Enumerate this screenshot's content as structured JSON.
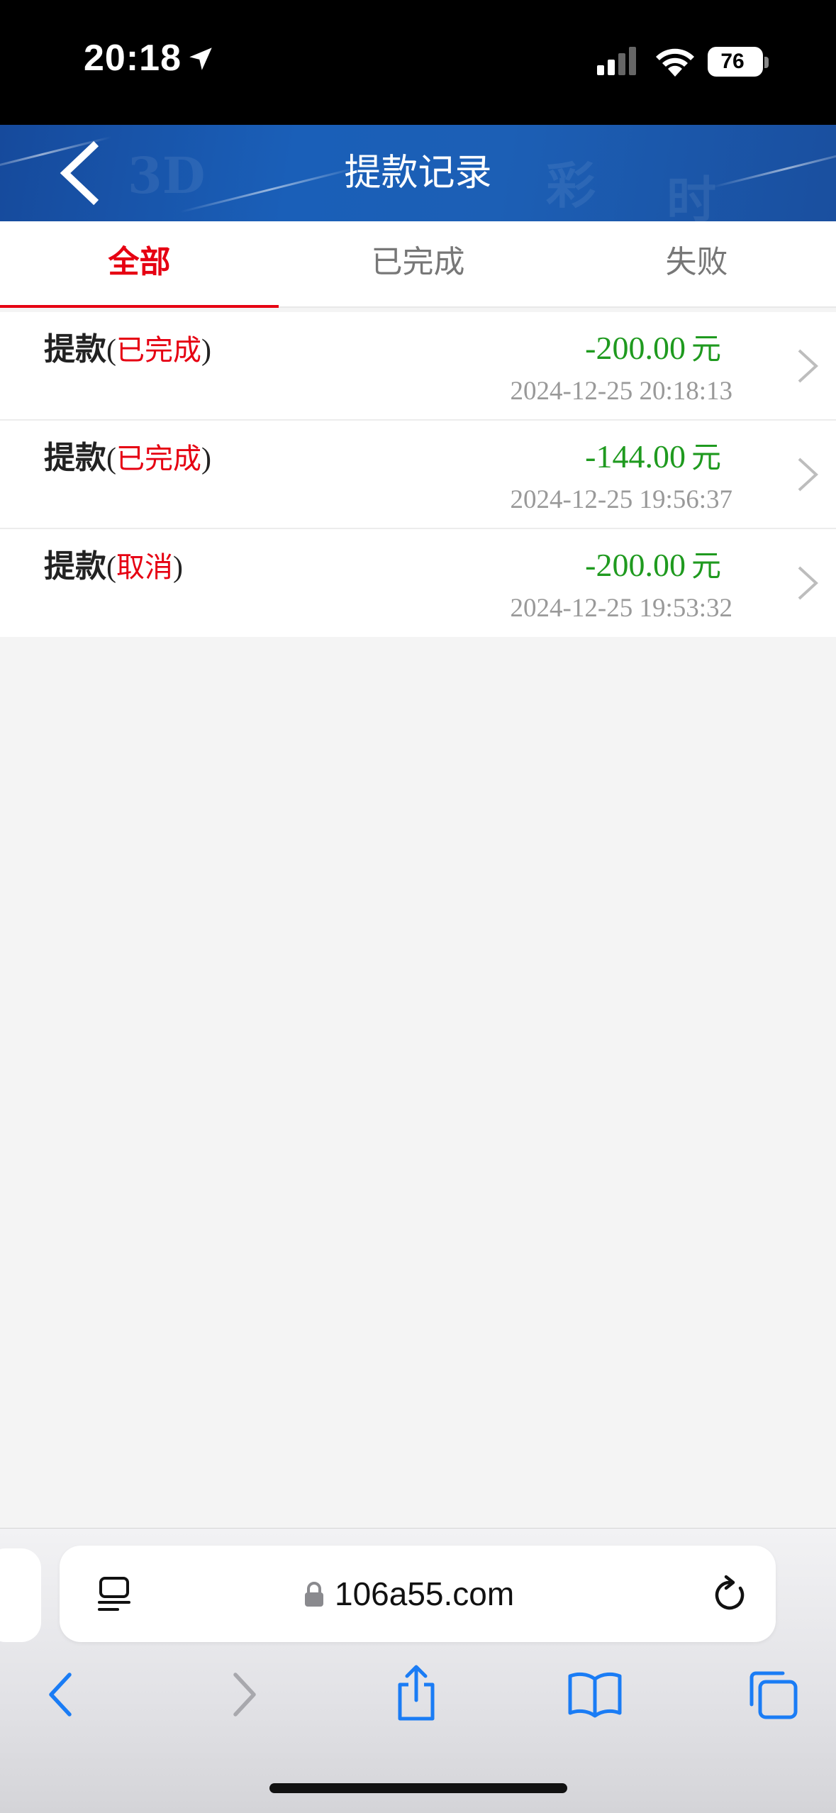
{
  "status_bar": {
    "time": "20:18",
    "battery": "76",
    "icons": [
      "location-arrow-icon",
      "cellular-signal-icon",
      "wifi-icon",
      "battery-icon"
    ]
  },
  "header": {
    "title": "提款记录",
    "back_icon": "chevron-left-icon",
    "background_color": "#1a5cb0"
  },
  "tabs": [
    {
      "label": "全部",
      "active": true
    },
    {
      "label": "已完成",
      "active": false
    },
    {
      "label": "失败",
      "active": false
    }
  ],
  "records": [
    {
      "kind": "提款",
      "open": "(",
      "status": "已完成",
      "close": ")",
      "amount": "-200.00",
      "unit": "元",
      "time": "2024-12-25 20:18:13"
    },
    {
      "kind": "提款",
      "open": "(",
      "status": "已完成",
      "close": ")",
      "amount": "-144.00",
      "unit": "元",
      "time": "2024-12-25 19:56:37"
    },
    {
      "kind": "提款",
      "open": "(",
      "status": "取消",
      "close": ")",
      "amount": "-200.00",
      "unit": "元",
      "time": "2024-12-25 19:53:32"
    }
  ],
  "browser": {
    "url": "106a55.com",
    "toolbar_icons": [
      "back-icon",
      "forward-icon",
      "share-icon",
      "bookmarks-icon",
      "tabs-icon"
    ]
  },
  "colors": {
    "accent_red": "#e60012",
    "amount_green": "#1f9a1f",
    "ios_blue": "#1a7cf5"
  }
}
